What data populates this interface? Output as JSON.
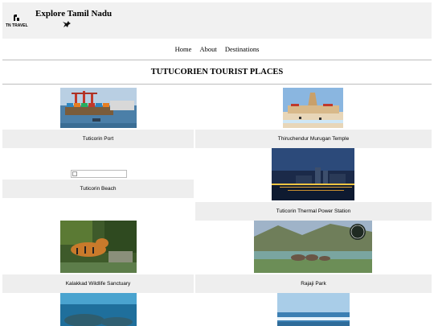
{
  "header": {
    "logo_text": "TN TRAVEL",
    "site_title": "Explore Tamil Nadu"
  },
  "nav": {
    "items": [
      "Home",
      "About",
      "Destinations"
    ]
  },
  "page": {
    "title": "TUTUCORIEN TOURIST PLACES"
  },
  "places": [
    {
      "name": "Tuticorin Port"
    },
    {
      "name": "Thiruchendur Murugan Temple"
    },
    {
      "name": "Tuticorin Beach"
    },
    {
      "name": "Tuticorin Thermal Power Station"
    },
    {
      "name": "Kalakkad Wildlife Sanctuary"
    },
    {
      "name": "Rajaji Park"
    }
  ],
  "colors": {
    "header_bg": "#f1f1f1",
    "caption_bg": "#eeeeee",
    "divider": "#bdbdbd"
  }
}
